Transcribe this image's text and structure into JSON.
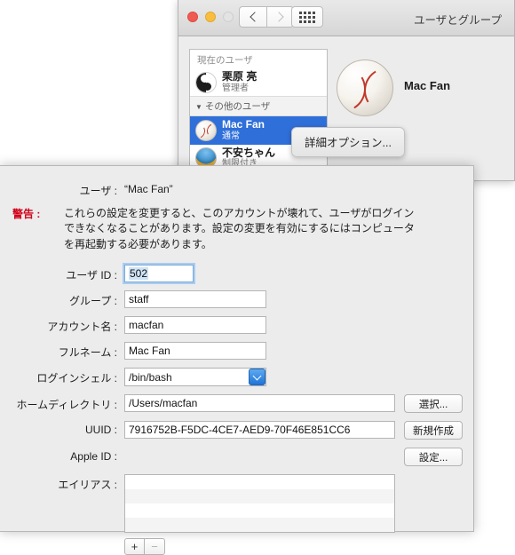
{
  "window": {
    "title": "ユーザとグループ",
    "traffic": {
      "close": "close-button",
      "minimize": "minimize-button",
      "zoom": "zoom-button"
    },
    "nav": {
      "back": "back-button",
      "forward": "forward-button",
      "show_all": "show-all-button"
    }
  },
  "user_list": {
    "current_header": "現在のユーザ",
    "current_user": {
      "name": "栗原 亮",
      "role": "管理者",
      "avatar": "yinyang-avatar"
    },
    "other_group": "その他のユーザ",
    "other_users": [
      {
        "name": "Mac Fan",
        "role": "通常",
        "avatar": "baseball-avatar",
        "selected": true
      },
      {
        "name": "不安ちゃん",
        "role": "制限付き",
        "avatar": "flower-avatar",
        "selected": false
      }
    ]
  },
  "user_pane": {
    "name": "Mac Fan",
    "avatar": "baseball-avatar"
  },
  "context_menu": {
    "items": [
      "詳細オプション..."
    ]
  },
  "sheet": {
    "user_label": "ユーザ :",
    "user_value": "“Mac Fan”",
    "warning_label": "警告 :",
    "warning_text": "これらの設定を変更すると、このアカウントが壊れて、ユーザがログインできなくなることがあります。設定の変更を有効にするにはコンピュータを再起動する必要があります。",
    "fields": {
      "user_id": {
        "label": "ユーザ ID :",
        "value": "502",
        "focused": true
      },
      "group": {
        "label": "グループ :",
        "value": "staff"
      },
      "account_name": {
        "label": "アカウント名 :",
        "value": "macfan"
      },
      "full_name": {
        "label": "フルネーム :",
        "value": "Mac Fan"
      },
      "login_shell": {
        "label": "ログインシェル :",
        "value": "/bin/bash"
      },
      "home_directory": {
        "label": "ホームディレクトリ :",
        "value": "/Users/macfan",
        "button": "選択..."
      },
      "uuid": {
        "label": "UUID :",
        "value": "7916752B-F5DC-4CE7-AED9-70F46E851CC6",
        "button": "新規作成"
      },
      "apple_id": {
        "label": "Apple ID :",
        "value": "",
        "button": "設定..."
      },
      "aliases": {
        "label": "エイリアス :",
        "items": [],
        "add": "+",
        "remove": "−"
      }
    }
  },
  "colors": {
    "selection_blue": "#2f6fd9",
    "warning_red": "#d0021b",
    "focus_ring": "#a8cdf0",
    "window_bg": "#ececec"
  }
}
